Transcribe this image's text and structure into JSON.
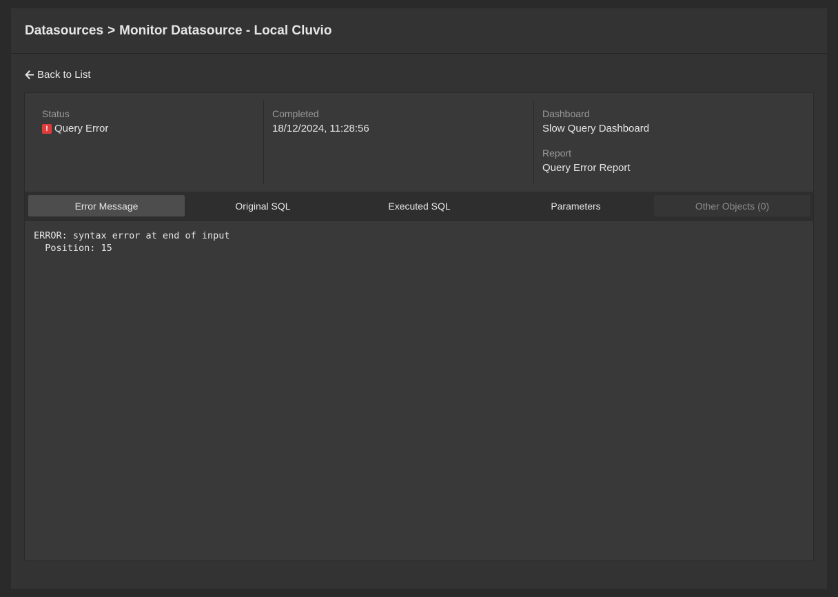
{
  "header": {
    "breadcrumb_root": "Datasources",
    "breadcrumb_sep": ">",
    "breadcrumb_current": "Monitor Datasource - Local Cluvio"
  },
  "back_link": {
    "label": "Back to List",
    "icon": "arrow-left-icon"
  },
  "info": {
    "status_label": "Status",
    "status_value": "Query Error",
    "status_icon": "error-icon",
    "status_color": "#e03b3b",
    "completed_label": "Completed",
    "completed_value": "18/12/2024, 11:28:56",
    "dashboard_label": "Dashboard",
    "dashboard_value": "Slow Query Dashboard",
    "report_label": "Report",
    "report_value": "Query Error Report"
  },
  "tabs": [
    {
      "label": "Error Message",
      "state": "active"
    },
    {
      "label": "Original SQL",
      "state": "normal"
    },
    {
      "label": "Executed SQL",
      "state": "normal"
    },
    {
      "label": "Parameters",
      "state": "normal"
    },
    {
      "label": "Other Objects (0)",
      "state": "disabled"
    }
  ],
  "content": {
    "error_text": "ERROR: syntax error at end of input\n  Position: 15"
  }
}
